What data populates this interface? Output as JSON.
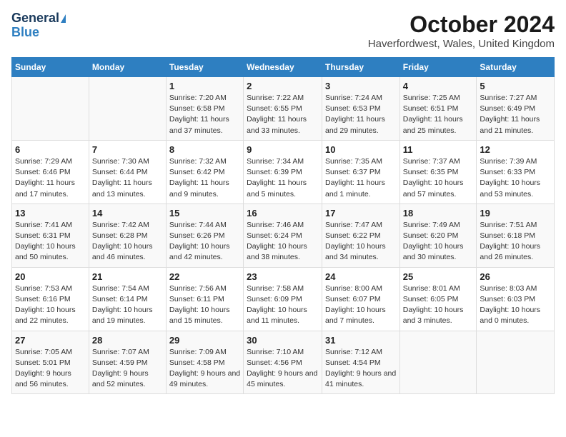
{
  "header": {
    "logo_general": "General",
    "logo_blue": "Blue",
    "title": "October 2024",
    "subtitle": "Haverfordwest, Wales, United Kingdom"
  },
  "columns": [
    "Sunday",
    "Monday",
    "Tuesday",
    "Wednesday",
    "Thursday",
    "Friday",
    "Saturday"
  ],
  "weeks": [
    [
      {
        "day": "",
        "info": ""
      },
      {
        "day": "",
        "info": ""
      },
      {
        "day": "1",
        "info": "Sunrise: 7:20 AM\nSunset: 6:58 PM\nDaylight: 11 hours and 37 minutes."
      },
      {
        "day": "2",
        "info": "Sunrise: 7:22 AM\nSunset: 6:55 PM\nDaylight: 11 hours and 33 minutes."
      },
      {
        "day": "3",
        "info": "Sunrise: 7:24 AM\nSunset: 6:53 PM\nDaylight: 11 hours and 29 minutes."
      },
      {
        "day": "4",
        "info": "Sunrise: 7:25 AM\nSunset: 6:51 PM\nDaylight: 11 hours and 25 minutes."
      },
      {
        "day": "5",
        "info": "Sunrise: 7:27 AM\nSunset: 6:49 PM\nDaylight: 11 hours and 21 minutes."
      }
    ],
    [
      {
        "day": "6",
        "info": "Sunrise: 7:29 AM\nSunset: 6:46 PM\nDaylight: 11 hours and 17 minutes."
      },
      {
        "day": "7",
        "info": "Sunrise: 7:30 AM\nSunset: 6:44 PM\nDaylight: 11 hours and 13 minutes."
      },
      {
        "day": "8",
        "info": "Sunrise: 7:32 AM\nSunset: 6:42 PM\nDaylight: 11 hours and 9 minutes."
      },
      {
        "day": "9",
        "info": "Sunrise: 7:34 AM\nSunset: 6:39 PM\nDaylight: 11 hours and 5 minutes."
      },
      {
        "day": "10",
        "info": "Sunrise: 7:35 AM\nSunset: 6:37 PM\nDaylight: 11 hours and 1 minute."
      },
      {
        "day": "11",
        "info": "Sunrise: 7:37 AM\nSunset: 6:35 PM\nDaylight: 10 hours and 57 minutes."
      },
      {
        "day": "12",
        "info": "Sunrise: 7:39 AM\nSunset: 6:33 PM\nDaylight: 10 hours and 53 minutes."
      }
    ],
    [
      {
        "day": "13",
        "info": "Sunrise: 7:41 AM\nSunset: 6:31 PM\nDaylight: 10 hours and 50 minutes."
      },
      {
        "day": "14",
        "info": "Sunrise: 7:42 AM\nSunset: 6:28 PM\nDaylight: 10 hours and 46 minutes."
      },
      {
        "day": "15",
        "info": "Sunrise: 7:44 AM\nSunset: 6:26 PM\nDaylight: 10 hours and 42 minutes."
      },
      {
        "day": "16",
        "info": "Sunrise: 7:46 AM\nSunset: 6:24 PM\nDaylight: 10 hours and 38 minutes."
      },
      {
        "day": "17",
        "info": "Sunrise: 7:47 AM\nSunset: 6:22 PM\nDaylight: 10 hours and 34 minutes."
      },
      {
        "day": "18",
        "info": "Sunrise: 7:49 AM\nSunset: 6:20 PM\nDaylight: 10 hours and 30 minutes."
      },
      {
        "day": "19",
        "info": "Sunrise: 7:51 AM\nSunset: 6:18 PM\nDaylight: 10 hours and 26 minutes."
      }
    ],
    [
      {
        "day": "20",
        "info": "Sunrise: 7:53 AM\nSunset: 6:16 PM\nDaylight: 10 hours and 22 minutes."
      },
      {
        "day": "21",
        "info": "Sunrise: 7:54 AM\nSunset: 6:14 PM\nDaylight: 10 hours and 19 minutes."
      },
      {
        "day": "22",
        "info": "Sunrise: 7:56 AM\nSunset: 6:11 PM\nDaylight: 10 hours and 15 minutes."
      },
      {
        "day": "23",
        "info": "Sunrise: 7:58 AM\nSunset: 6:09 PM\nDaylight: 10 hours and 11 minutes."
      },
      {
        "day": "24",
        "info": "Sunrise: 8:00 AM\nSunset: 6:07 PM\nDaylight: 10 hours and 7 minutes."
      },
      {
        "day": "25",
        "info": "Sunrise: 8:01 AM\nSunset: 6:05 PM\nDaylight: 10 hours and 3 minutes."
      },
      {
        "day": "26",
        "info": "Sunrise: 8:03 AM\nSunset: 6:03 PM\nDaylight: 10 hours and 0 minutes."
      }
    ],
    [
      {
        "day": "27",
        "info": "Sunrise: 7:05 AM\nSunset: 5:01 PM\nDaylight: 9 hours and 56 minutes."
      },
      {
        "day": "28",
        "info": "Sunrise: 7:07 AM\nSunset: 4:59 PM\nDaylight: 9 hours and 52 minutes."
      },
      {
        "day": "29",
        "info": "Sunrise: 7:09 AM\nSunset: 4:58 PM\nDaylight: 9 hours and 49 minutes."
      },
      {
        "day": "30",
        "info": "Sunrise: 7:10 AM\nSunset: 4:56 PM\nDaylight: 9 hours and 45 minutes."
      },
      {
        "day": "31",
        "info": "Sunrise: 7:12 AM\nSunset: 4:54 PM\nDaylight: 9 hours and 41 minutes."
      },
      {
        "day": "",
        "info": ""
      },
      {
        "day": "",
        "info": ""
      }
    ]
  ]
}
